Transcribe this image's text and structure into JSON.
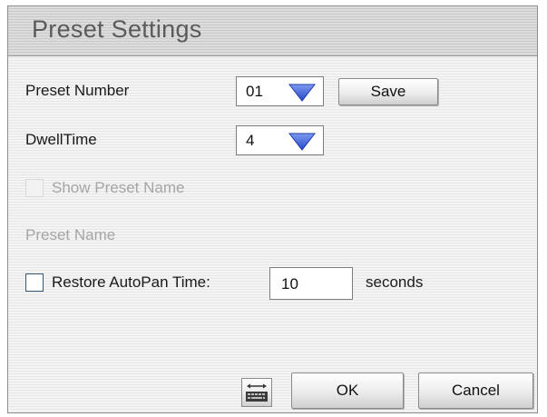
{
  "dialog": {
    "title": "Preset Settings"
  },
  "preset_number": {
    "label": "Preset Number",
    "value": "01",
    "save_label": "Save"
  },
  "dwell_time": {
    "label": "DwellTime",
    "value": "4"
  },
  "show_preset_name": {
    "label": "Show Preset Name",
    "checked": false,
    "enabled": false
  },
  "preset_name": {
    "label": "Preset Name",
    "enabled": false
  },
  "restore_autopan": {
    "label": "Restore AutoPan Time:",
    "checked": false,
    "value": "10",
    "unit": "seconds"
  },
  "footer": {
    "keyboard_icon": "keyboard-icon",
    "ok_label": "OK",
    "cancel_label": "Cancel"
  },
  "colors": {
    "arrow": "#3d63d8",
    "checkbox_border": "#3b5778",
    "disabled_text": "#a5a5a5"
  }
}
